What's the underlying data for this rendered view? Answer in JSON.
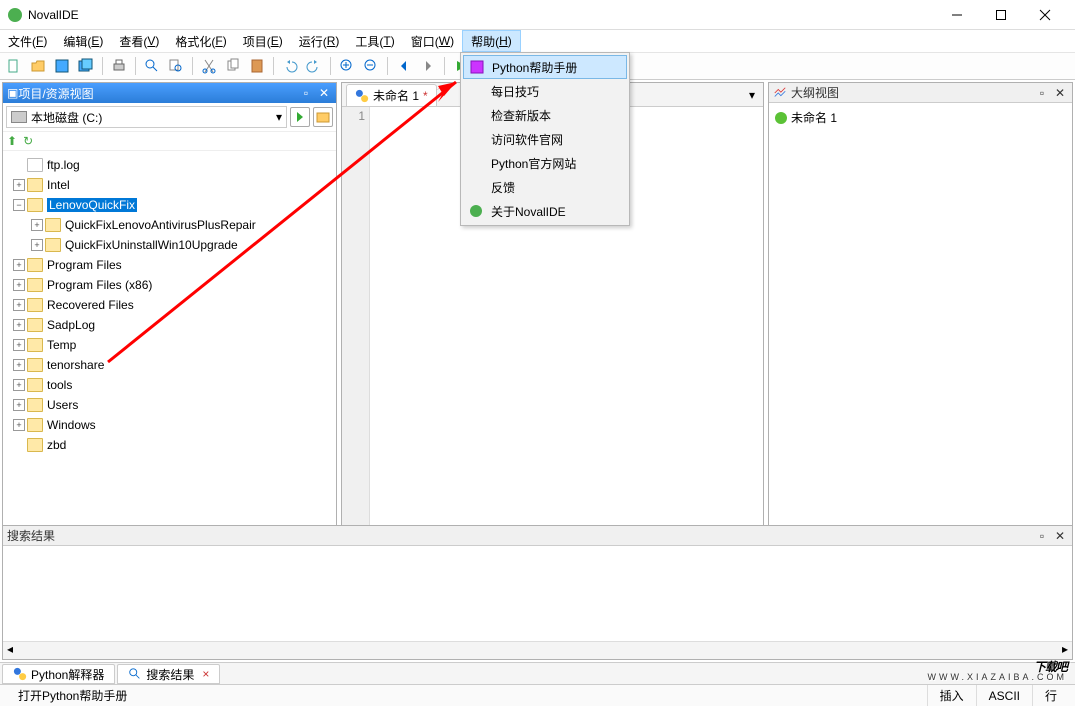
{
  "app": {
    "title": "NovalIDE"
  },
  "menubar": [
    {
      "label": "文件",
      "accel": "F"
    },
    {
      "label": "编辑",
      "accel": "E"
    },
    {
      "label": "查看",
      "accel": "V"
    },
    {
      "label": "格式化",
      "accel": "F"
    },
    {
      "label": "项目",
      "accel": "E"
    },
    {
      "label": "运行",
      "accel": "R"
    },
    {
      "label": "工具",
      "accel": "T"
    },
    {
      "label": "窗口",
      "accel": "W"
    },
    {
      "label": "帮助",
      "accel": "H"
    }
  ],
  "help_menu": [
    {
      "label": "Python帮助手册",
      "icon": "book",
      "hl": true
    },
    {
      "label": "每日技巧"
    },
    {
      "label": "检查新版本"
    },
    {
      "label": "访问软件官网"
    },
    {
      "label": "Python官方网站"
    },
    {
      "label": "反馈"
    },
    {
      "label": "关于NovalIDE",
      "icon": "about"
    }
  ],
  "left": {
    "title": "项目/资源视图",
    "drive": "本地磁盘 (C:)",
    "tree": [
      {
        "d": 0,
        "exp": "",
        "type": "file",
        "label": "ftp.log"
      },
      {
        "d": 0,
        "exp": "+",
        "type": "folder",
        "label": "Intel"
      },
      {
        "d": 0,
        "exp": "-",
        "type": "folder",
        "label": "LenovoQuickFix",
        "sel": true
      },
      {
        "d": 1,
        "exp": "+",
        "type": "folder",
        "label": "QuickFixLenovoAntivirusPlusRepair"
      },
      {
        "d": 1,
        "exp": "+",
        "type": "folder",
        "label": "QuickFixUninstallWin10Upgrade"
      },
      {
        "d": 0,
        "exp": "+",
        "type": "folder",
        "label": "Program Files"
      },
      {
        "d": 0,
        "exp": "+",
        "type": "folder",
        "label": "Program Files (x86)"
      },
      {
        "d": 0,
        "exp": "+",
        "type": "folder",
        "label": "Recovered Files"
      },
      {
        "d": 0,
        "exp": "+",
        "type": "folder",
        "label": "SadpLog"
      },
      {
        "d": 0,
        "exp": "+",
        "type": "folder",
        "label": "Temp"
      },
      {
        "d": 0,
        "exp": "+",
        "type": "folder",
        "label": "tenorshare"
      },
      {
        "d": 0,
        "exp": "+",
        "type": "folder",
        "label": "tools"
      },
      {
        "d": 0,
        "exp": "+",
        "type": "folder",
        "label": "Users"
      },
      {
        "d": 0,
        "exp": "+",
        "type": "folder",
        "label": "Windows"
      },
      {
        "d": 0,
        "exp": "",
        "type": "folder",
        "label": "zbd"
      }
    ]
  },
  "center": {
    "tab": "未命名 1",
    "tabclose": "×",
    "line": "1"
  },
  "right": {
    "title": "大纲视图",
    "item": "未命名 1"
  },
  "search": {
    "title": "搜索结果"
  },
  "bottom_tabs": [
    {
      "label": "Python解释器",
      "icon": "python"
    },
    {
      "label": "搜索结果",
      "icon": "search",
      "close": true
    }
  ],
  "status": {
    "msg": "打开Python帮助手册",
    "mode": "插入",
    "enc": "ASCII",
    "grip": "行"
  },
  "watermark": {
    "big": "下载吧",
    "sub": "WWW.XIAZAIBA.COM"
  }
}
